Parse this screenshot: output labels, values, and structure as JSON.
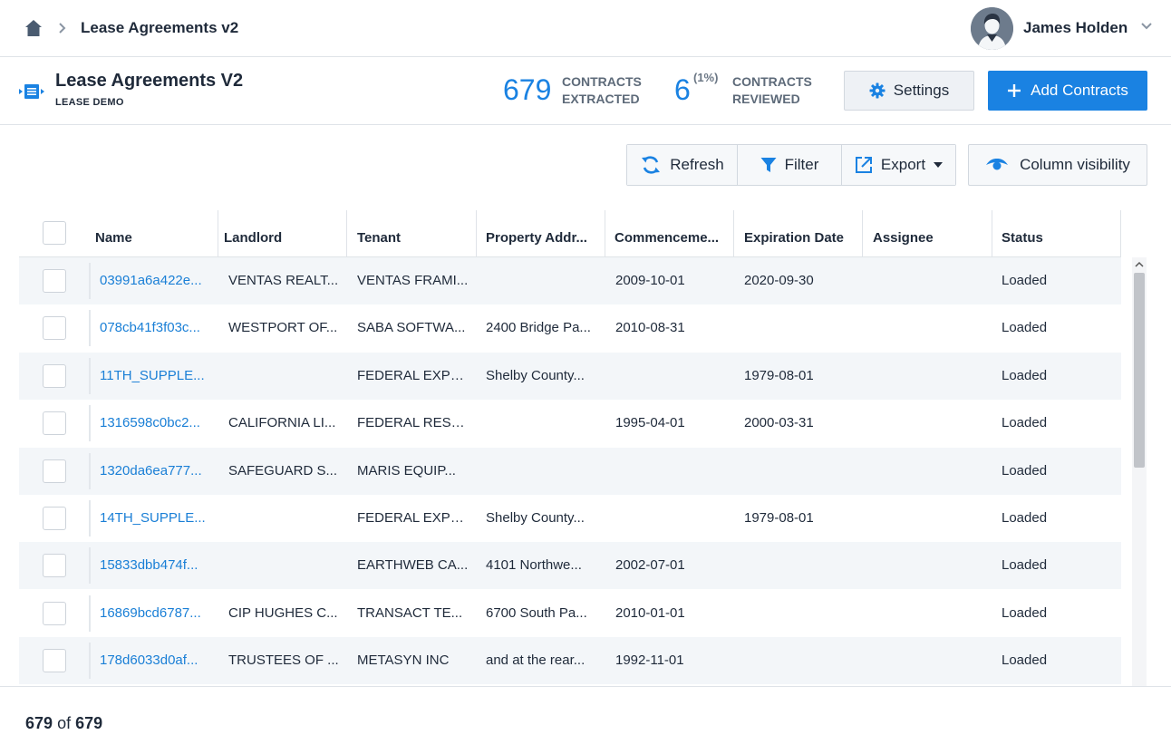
{
  "breadcrumb": {
    "title": "Lease Agreements v2"
  },
  "user": {
    "name": "James Holden"
  },
  "project": {
    "title": "Lease Agreements V2",
    "subtitle": "LEASE DEMO",
    "extracted_count": "679",
    "extracted_label_1": "CONTRACTS",
    "extracted_label_2": "EXTRACTED",
    "reviewed_count": "6",
    "reviewed_pct": "(1%)",
    "reviewed_label_1": "CONTRACTS",
    "reviewed_label_2": "REVIEWED"
  },
  "actions": {
    "settings": "Settings",
    "add": "Add Contracts"
  },
  "toolbar": {
    "refresh": "Refresh",
    "filter": "Filter",
    "export": "Export",
    "column_visibility": "Column visibility"
  },
  "colors": {
    "accent": "#1a82e2",
    "link": "#1a7fd6"
  },
  "table": {
    "columns": [
      "Name",
      "Landlord",
      "Tenant",
      "Property Addr...",
      "Commenceme...",
      "Expiration Date",
      "Assignee",
      "Status"
    ],
    "rows": [
      [
        "03991a6a422e...",
        "VENTAS REALT...",
        "VENTAS FRAMI...",
        "",
        "2009-10-01",
        "2020-09-30",
        "",
        "Loaded"
      ],
      [
        "078cb41f3f03c...",
        "WESTPORT OF...",
        "SABA SOFTWA...",
        "2400 Bridge Pa...",
        "2010-08-31",
        "",
        "",
        "Loaded"
      ],
      [
        "11TH_SUPPLE...",
        "",
        "FEDERAL EXPR...",
        "Shelby County...",
        "",
        "1979-08-01",
        "",
        "Loaded"
      ],
      [
        "1316598c0bc2...",
        "CALIFORNIA LI...",
        "FEDERAL RESE...",
        "",
        "1995-04-01",
        "2000-03-31",
        "",
        "Loaded"
      ],
      [
        "1320da6ea777...",
        "SAFEGUARD S...",
        "MARIS EQUIP...",
        "",
        "",
        "",
        "",
        "Loaded"
      ],
      [
        "14TH_SUPPLE...",
        "",
        "FEDERAL EXPR...",
        "Shelby County...",
        "",
        "1979-08-01",
        "",
        "Loaded"
      ],
      [
        "15833dbb474f...",
        "",
        "EARTHWEB CA...",
        "4101 Northwe...",
        "2002-07-01",
        "",
        "",
        "Loaded"
      ],
      [
        "16869bcd6787...",
        "CIP HUGHES C...",
        "TRANSACT TE...",
        "6700 South Pa...",
        "2010-01-01",
        "",
        "",
        "Loaded"
      ],
      [
        "178d6033d0af...",
        "TRUSTEES OF ...",
        "METASYN INC",
        "and at the rear...",
        "1992-11-01",
        "",
        "",
        "Loaded"
      ]
    ]
  },
  "footer": {
    "shown": "679",
    "of_label": "of",
    "total": "679"
  }
}
